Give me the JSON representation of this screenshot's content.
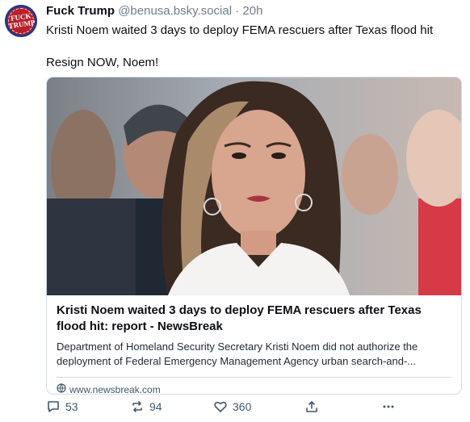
{
  "author": {
    "name": "Fuck Trump",
    "handle": "@benusa.bsky.social",
    "separator": "·",
    "time": "20h",
    "avatar_text": "FUCK TRUMP"
  },
  "post": {
    "text": "Kristi Noem waited 3 days to deploy FEMA rescuers after Texas flood hit\n\nResign NOW, Noem!"
  },
  "card": {
    "title": "Kristi Noem waited 3 days to deploy FEMA rescuers after Texas flood hit: report - NewsBreak",
    "description": "Department of Homeland Security Secretary Kristi Noem did not authorize the deployment of Federal Emergency Management Agency urban search-and-...",
    "domain": "www.newsbreak.com",
    "domain_icon": "globe-icon"
  },
  "actions": {
    "replies": "53",
    "reposts": "94",
    "likes": "360",
    "reply_icon": "reply-icon",
    "repost_icon": "repost-icon",
    "like_icon": "heart-icon",
    "share_icon": "share-icon",
    "more_icon": "more-icon"
  },
  "colors": {
    "text": "#0b0f14",
    "muted": "#6f7b8a",
    "border": "#d4dbe2",
    "avatar_red": "#b8202a",
    "avatar_blue": "#1f3a8a"
  }
}
